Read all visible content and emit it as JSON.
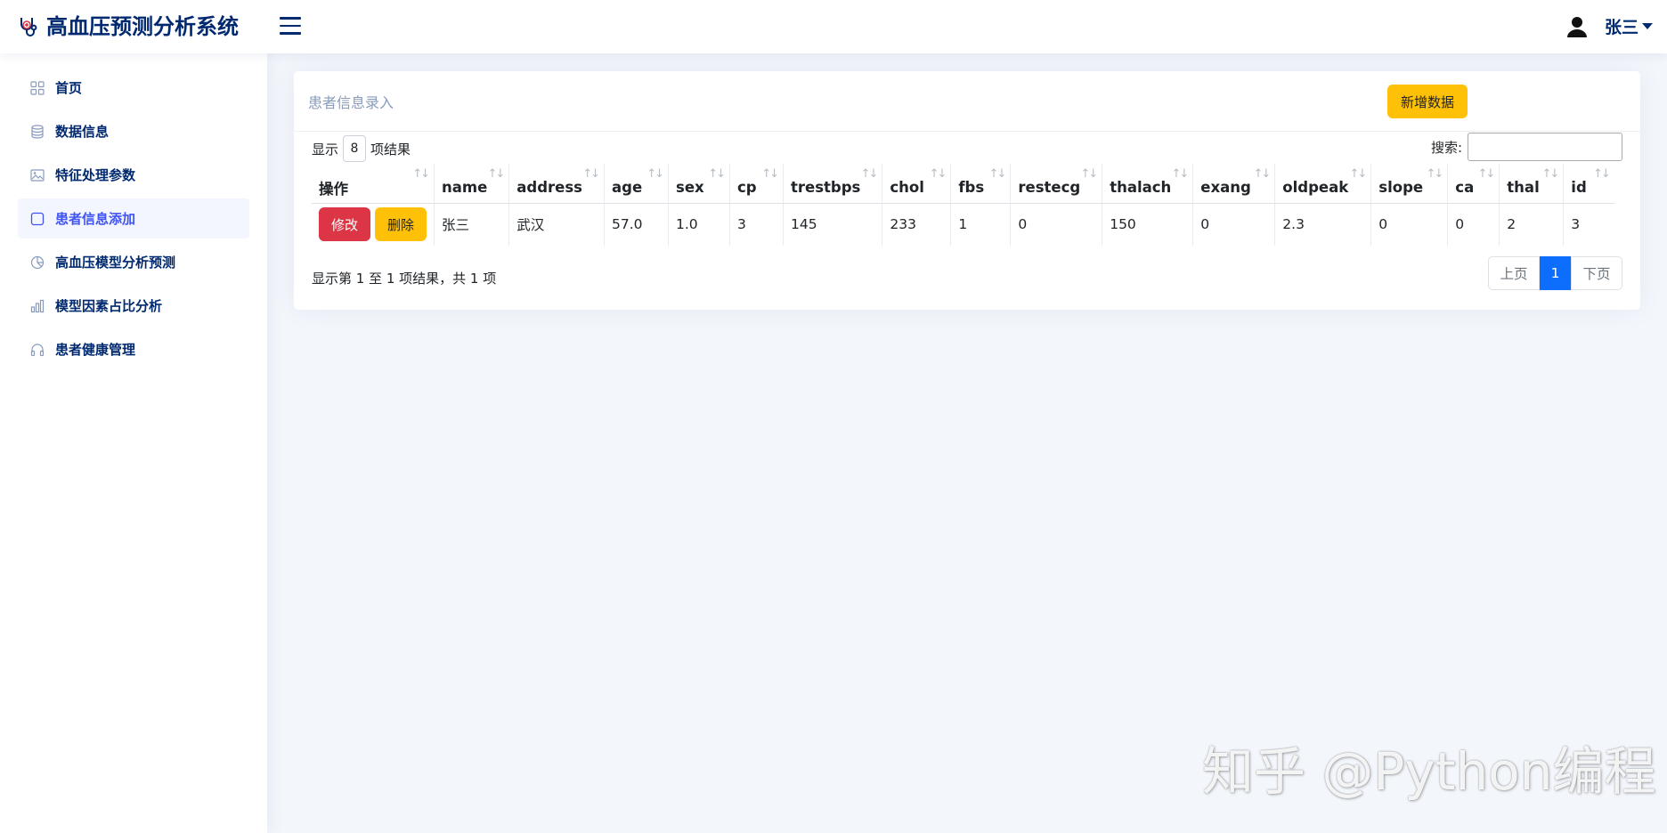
{
  "header": {
    "app_title": "高血压预测分析系统",
    "user_name": "张三"
  },
  "sidebar": {
    "items": [
      {
        "label": "首页",
        "icon": "grid-icon",
        "active": false
      },
      {
        "label": "数据信息",
        "icon": "database-icon",
        "active": false
      },
      {
        "label": "特征处理参数",
        "icon": "image-icon",
        "active": false
      },
      {
        "label": "患者信息添加",
        "icon": "square-icon",
        "active": true
      },
      {
        "label": "高血压模型分析预测",
        "icon": "pie-chart-icon",
        "active": false
      },
      {
        "label": "模型因素占比分析",
        "icon": "bar-chart-icon",
        "active": false
      },
      {
        "label": "患者健康管理",
        "icon": "headphones-icon",
        "active": false
      }
    ]
  },
  "card": {
    "title": "患者信息录入",
    "add_button": "新增数据"
  },
  "length_control": {
    "prefix": "显示",
    "value": "8",
    "suffix": "项结果"
  },
  "search": {
    "label": "搜索:",
    "value": ""
  },
  "table": {
    "columns": [
      "操作",
      "name",
      "address",
      "age",
      "sex",
      "cp",
      "trestbps",
      "chol",
      "fbs",
      "restecg",
      "thalach",
      "exang",
      "oldpeak",
      "slope",
      "ca",
      "thal",
      "id"
    ],
    "rows": [
      {
        "edit_label": "修改",
        "delete_label": "删除",
        "cells": [
          "张三",
          "武汉",
          "57.0",
          "1.0",
          "3",
          "145",
          "233",
          "1",
          "0",
          "150",
          "0",
          "2.3",
          "0",
          "0",
          "2",
          "3"
        ]
      }
    ]
  },
  "footer": {
    "info": "显示第 1 至 1 项结果，共 1 项",
    "prev": "上页",
    "current_page": "1",
    "next": "下页"
  },
  "watermark": "知乎 @Python编程",
  "colors": {
    "brand": "#012970",
    "active": "#4154f1",
    "danger": "#dc3545",
    "warning": "#ffc107",
    "primary": "#0d6efd"
  }
}
